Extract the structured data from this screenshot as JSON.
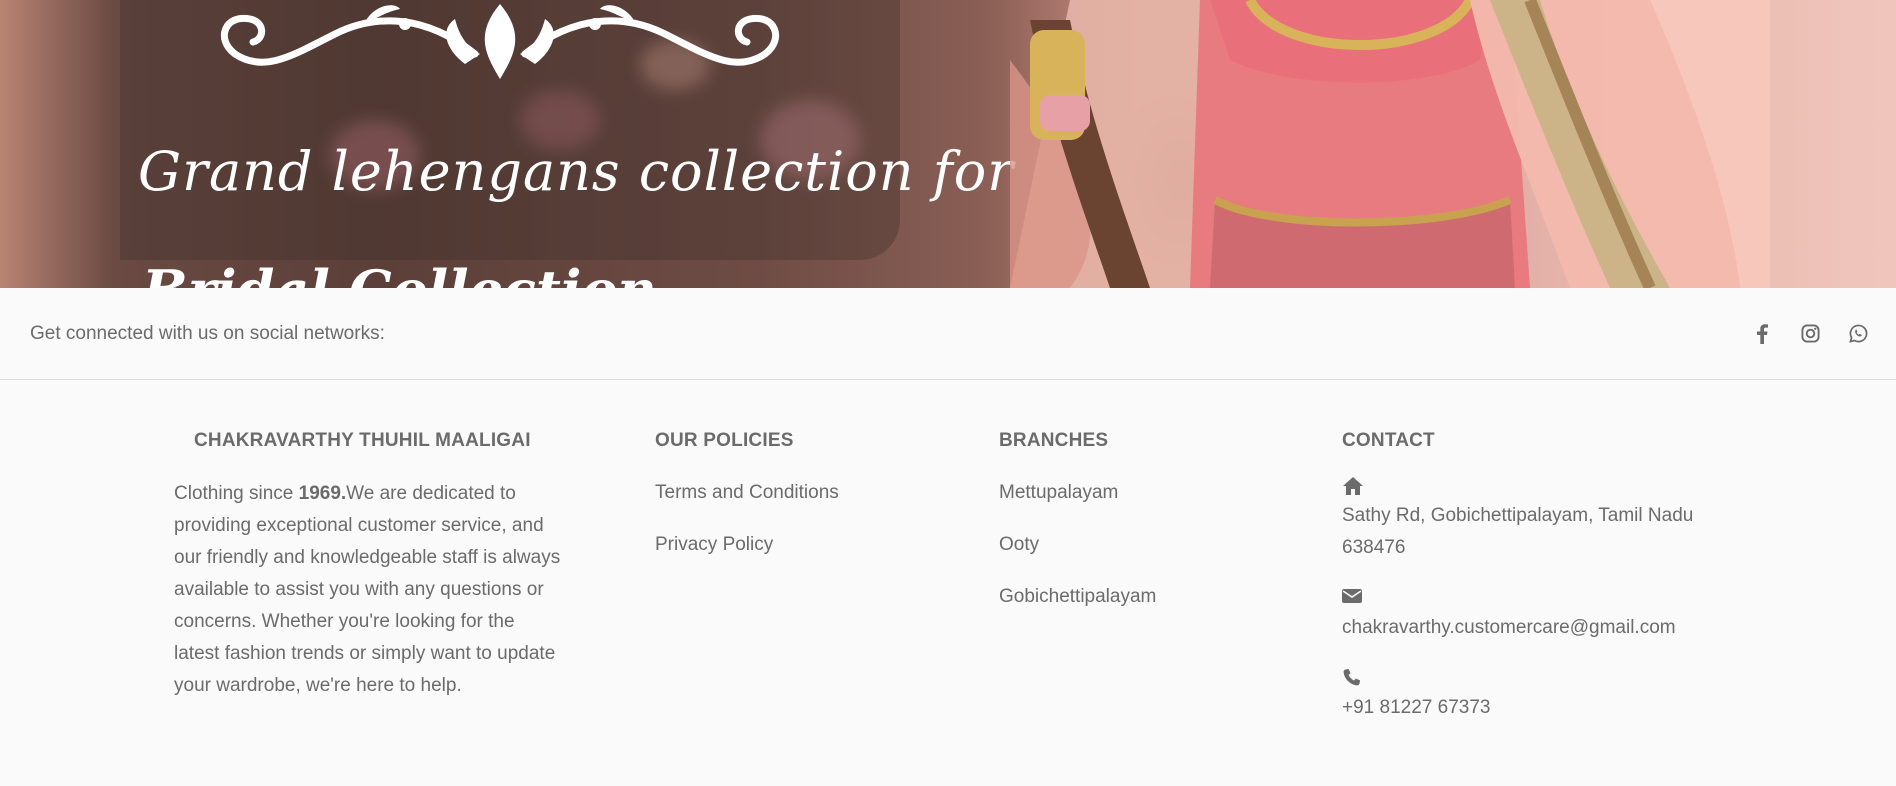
{
  "hero": {
    "title": "Grand lehengans collection for",
    "title_line2": "Bridal Collection"
  },
  "social": {
    "text": "Get connected with us on social networks:",
    "icons": [
      "facebook-icon",
      "instagram-icon",
      "whatsapp-icon"
    ]
  },
  "footer": {
    "about": {
      "heading": "CHAKRAVARTHY THUHIL MAALIGAI",
      "text_before": "Clothing since ",
      "year": "1969.",
      "text_after": "We are dedicated to providing exceptional customer service, and our friendly and knowledgeable staff is always available to assist you with any questions or concerns. Whether you're looking for the latest fashion trends or simply want to update your wardrobe, we're here to help."
    },
    "policies": {
      "heading": "OUR POLICIES",
      "items": [
        "Terms and Conditions",
        "Privacy Policy"
      ]
    },
    "branches": {
      "heading": "BRANCHES",
      "items": [
        "Mettupalayam",
        "Ooty",
        "Gobichettipalayam"
      ]
    },
    "contact": {
      "heading": "CONTACT",
      "address": "Sathy Rd, Gobichettipalayam, Tamil Nadu 638476",
      "email": "chakravarthy.customercare@gmail.com",
      "phone": "+91 81227 67373"
    }
  },
  "colors": {
    "text": "#6b6b6b",
    "background": "#fafafa",
    "divider": "#dcdcdc"
  }
}
